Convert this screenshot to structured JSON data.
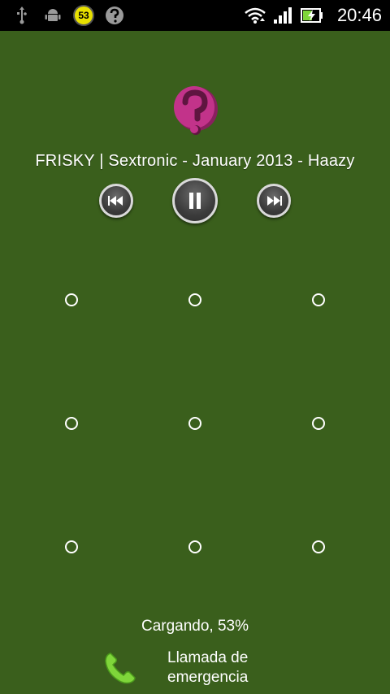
{
  "statusbar": {
    "left_icons": [
      "usb-icon",
      "android-debug-icon",
      "notification-53-badge",
      "question-app-icon"
    ],
    "badge_count": "53",
    "right_icons": [
      "wifi-icon",
      "signal-icon",
      "battery-charging-icon"
    ],
    "time": "20:46"
  },
  "music": {
    "track_title": "FRISKY | Sextronic - January 2013 - Haazy",
    "album_icon": "frisky-logo-icon",
    "controls": [
      "previous-icon",
      "pause-icon",
      "next-icon"
    ]
  },
  "pattern": {
    "rows": 3,
    "cols": 3
  },
  "footer": {
    "charging_text": "Cargando, 53%",
    "emergency_line1": "Llamada de",
    "emergency_line2": "emergencia"
  },
  "colors": {
    "background": "#3a5f1c",
    "statusbar": "#000000",
    "logo": "#c2338a",
    "phone": "#7fd63a"
  }
}
